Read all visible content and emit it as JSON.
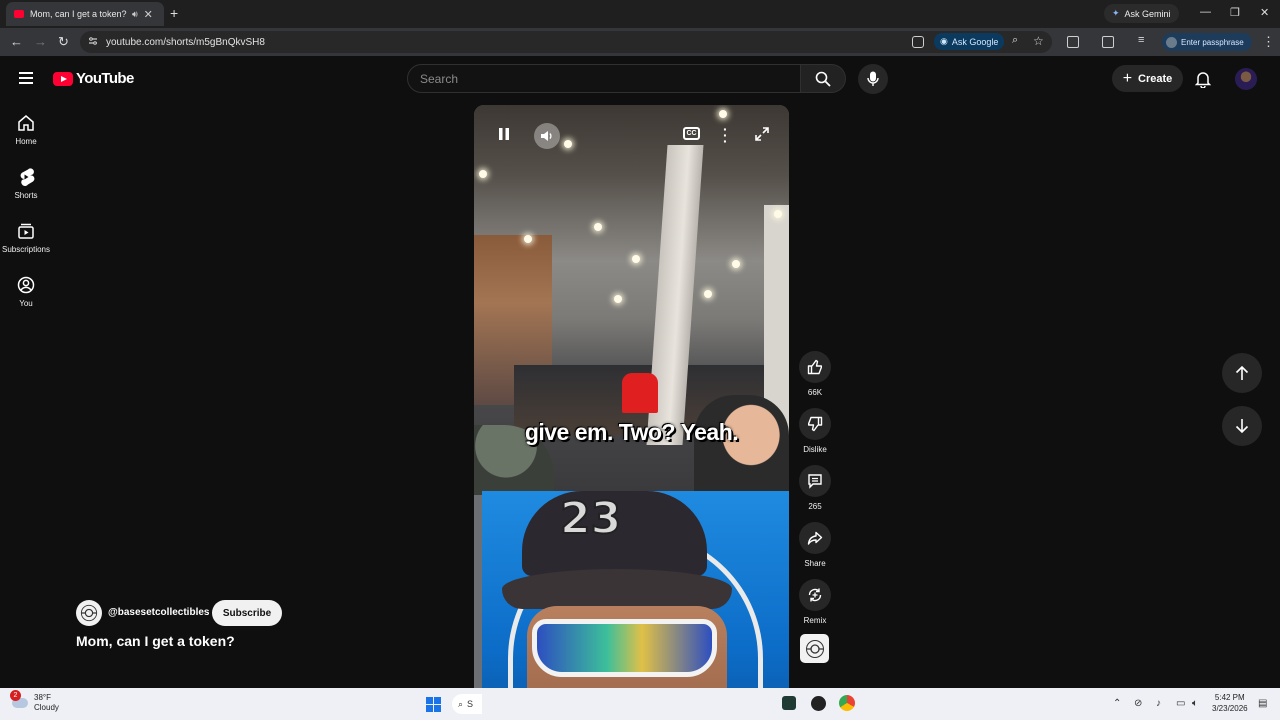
{
  "browser": {
    "tab_title": "Mom, can I get a token? - YouTube",
    "ask_gemini": "Ask Gemini",
    "url": "youtube.com/shorts/m5gBnQkvSH8",
    "ask_google": "Ask Google",
    "passphrase": "Enter passphrase"
  },
  "header": {
    "logo_text": "YouTube",
    "search_placeholder": "Search",
    "create_label": "Create"
  },
  "sidebar": {
    "items": [
      {
        "label": "Home",
        "icon": "home-icon"
      },
      {
        "label": "Shorts",
        "icon": "shorts-icon"
      },
      {
        "label": "Subscriptions",
        "icon": "subscriptions-icon"
      },
      {
        "label": "You",
        "icon": "you-icon"
      }
    ]
  },
  "video": {
    "caption": "give em. Two? Yeah.",
    "cc_label": "CC"
  },
  "actions": {
    "likes": "66K",
    "dislike": "Dislike",
    "comments": "265",
    "share": "Share",
    "remix": "Remix"
  },
  "channel": {
    "handle": "@basesetcollectibles",
    "subscribe": "Subscribe",
    "title": "Mom, can I get a token?"
  },
  "taskbar": {
    "weather_temp": "38°F",
    "weather_desc": "Cloudy",
    "weather_badge": "2",
    "search_label": "S",
    "time": "5:42 PM",
    "date": "3/23/2026"
  },
  "colors": {
    "brand": "#ff0033",
    "background": "#0f0f0f",
    "surface": "#272727"
  }
}
